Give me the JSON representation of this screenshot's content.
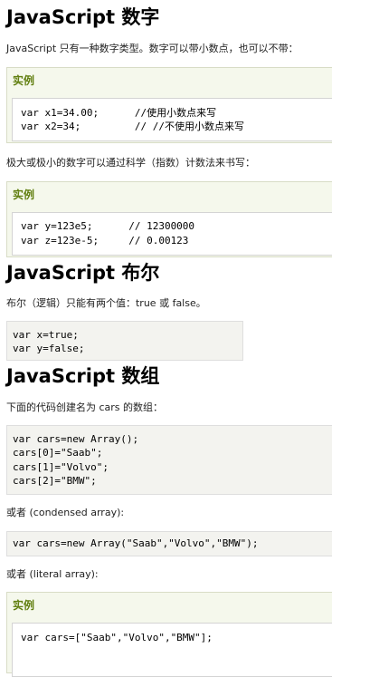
{
  "sections": {
    "numbers": {
      "title": "JavaScript 数字",
      "intro": "JavaScript 只有一种数字类型。数字可以带小数点，也可以不带：",
      "example1": {
        "label": "实例",
        "lines": [
          "var x1=34.00;      //使用小数点来写",
          "var x2=34;         // //不使用小数点来写"
        ]
      },
      "sci_intro": "极大或极小的数字可以通过科学（指数）计数法来书写：",
      "example2": {
        "label": "实例",
        "lines": [
          "var y=123e5;      // 12300000",
          "var z=123e-5;     // 0.00123"
        ]
      }
    },
    "booleans": {
      "title": "JavaScript 布尔",
      "intro": "布尔（逻辑）只能有两个值：true 或 false。",
      "lines": [
        "var x=true;",
        "var y=false;"
      ]
    },
    "arrays": {
      "title": "JavaScript 数组",
      "intro": "下面的代码创建名为 cars 的数组：",
      "lines": [
        "var cars=new Array();",
        "cars[0]=\"Saab\";",
        "cars[1]=\"Volvo\";",
        "cars[2]=\"BMW\";"
      ],
      "condensed_intro": "或者 (condensed array):",
      "condensed_line": "var cars=new Array(\"Saab\",\"Volvo\",\"BMW\");",
      "literal_intro": "或者 (literal array):",
      "example3": {
        "label": "实例",
        "lines": [
          "var cars=[\"Saab\",\"Volvo\",\"BMW\"];"
        ]
      }
    }
  },
  "colors": {
    "example_label": "#617f10",
    "example_bg": "#f5f8ec",
    "code_box_bg": "#f3f3ef"
  }
}
